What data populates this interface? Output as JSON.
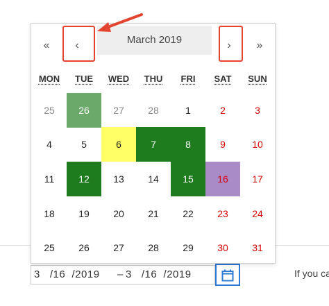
{
  "calendar": {
    "month_title": "March 2019",
    "nav": {
      "prev_year": "«",
      "prev_month": "‹",
      "next_month": "›",
      "next_year": "»"
    },
    "weekdays": [
      "MON",
      "TUE",
      "WED",
      "THU",
      "FRI",
      "SAT",
      "SUN"
    ],
    "weeks": [
      [
        {
          "d": "25",
          "s": "out"
        },
        {
          "d": "26",
          "s": "out",
          "bg": "#6aa96a",
          "fg": "#ffffff"
        },
        {
          "d": "27",
          "s": "out"
        },
        {
          "d": "28",
          "s": "out"
        },
        {
          "d": "1",
          "s": ""
        },
        {
          "d": "2",
          "s": "weekend"
        },
        {
          "d": "3",
          "s": "weekend"
        }
      ],
      [
        {
          "d": "4",
          "s": ""
        },
        {
          "d": "5",
          "s": ""
        },
        {
          "d": "6",
          "s": "",
          "bg": "#ffff66",
          "fg": "#222222"
        },
        {
          "d": "7",
          "s": "",
          "bg": "#1e7b1e",
          "fg": "#ffffff"
        },
        {
          "d": "8",
          "s": "",
          "bg": "#1e7b1e",
          "fg": "#ffffff"
        },
        {
          "d": "9",
          "s": "weekend"
        },
        {
          "d": "10",
          "s": "weekend"
        }
      ],
      [
        {
          "d": "11",
          "s": ""
        },
        {
          "d": "12",
          "s": "",
          "bg": "#1e7b1e",
          "fg": "#ffffff"
        },
        {
          "d": "13",
          "s": ""
        },
        {
          "d": "14",
          "s": ""
        },
        {
          "d": "15",
          "s": "",
          "bg": "#1e7b1e",
          "fg": "#ffffff"
        },
        {
          "d": "16",
          "s": "weekend",
          "bg": "#a98bc8",
          "fg": "#d40000"
        },
        {
          "d": "17",
          "s": "weekend"
        }
      ],
      [
        {
          "d": "18",
          "s": ""
        },
        {
          "d": "19",
          "s": ""
        },
        {
          "d": "20",
          "s": ""
        },
        {
          "d": "21",
          "s": ""
        },
        {
          "d": "22",
          "s": ""
        },
        {
          "d": "23",
          "s": "weekend"
        },
        {
          "d": "24",
          "s": "weekend"
        }
      ],
      [
        {
          "d": "25",
          "s": ""
        },
        {
          "d": "26",
          "s": ""
        },
        {
          "d": "27",
          "s": ""
        },
        {
          "d": "28",
          "s": ""
        },
        {
          "d": "29",
          "s": ""
        },
        {
          "d": "30",
          "s": "weekend"
        },
        {
          "d": "31",
          "s": "weekend"
        }
      ]
    ]
  },
  "date_range": {
    "start": "3   /16  /2019",
    "separator": "–",
    "end": "3   /16  /2019"
  },
  "calendar_button_icon": "calendar-icon",
  "side_text": "If you ca",
  "colors": {
    "annotation": "#e2442f",
    "focus": "#2b7bd6",
    "weekend": "#d40000"
  }
}
